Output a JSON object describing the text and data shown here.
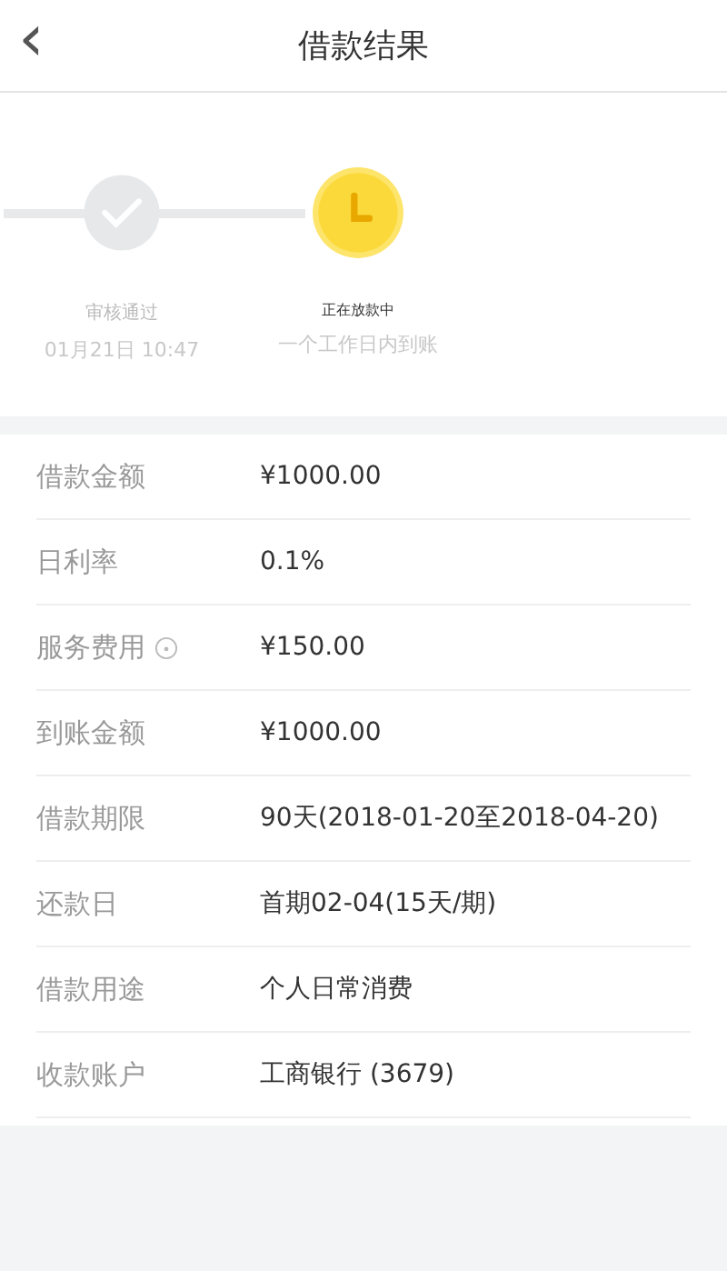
{
  "header": {
    "back_icon": "‹",
    "title": "借款结果"
  },
  "steps": [
    {
      "done": true,
      "label": "审核通过",
      "note": "01月21日 10:47"
    },
    {
      "done": false,
      "label": "正在放款中",
      "note": "一个工作日内到账"
    }
  ],
  "details": [
    {
      "label": "借款金额",
      "value": "¥1000.00",
      "info": false
    },
    {
      "label": "日利率",
      "value": "0.1%",
      "info": false
    },
    {
      "label": "服务费用",
      "value": "¥150.00",
      "info": true
    },
    {
      "label": "到账金额",
      "value": "¥1000.00",
      "info": false
    },
    {
      "label": "借款期限",
      "value": "90天(2018-01-20至2018-04-20)",
      "info": false
    },
    {
      "label": "还款日",
      "value": "首期02-04(15天/期)",
      "info": false
    },
    {
      "label": "借款用途",
      "value": "个人日常消费",
      "info": false
    },
    {
      "label": "收款账户",
      "value": "工商银行 (3679)",
      "info": false
    }
  ]
}
